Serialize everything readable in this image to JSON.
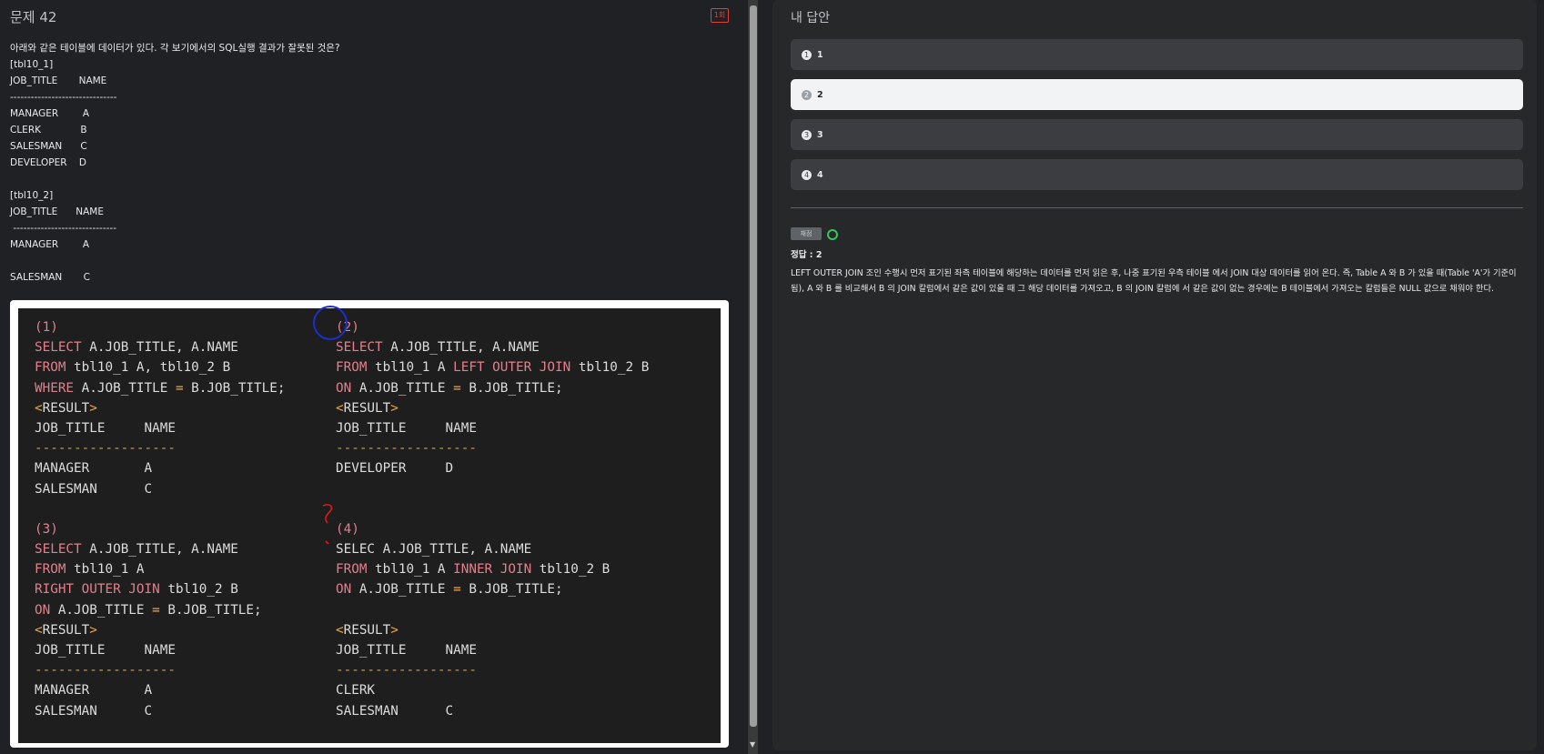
{
  "question": {
    "title": "문제 42",
    "badge": "1회",
    "lines": [
      "아래와 같은 테이블에 데이터가 있다. 각 보기에서의 SQL실행 결과가 잘못된 것은?",
      "[tbl10_1]",
      "JOB_TITLE       NAME",
      "-------------------------------",
      "MANAGER        A",
      "CLERK             B",
      "SALESMAN      C",
      "DEVELOPER    D",
      "",
      "[tbl10_2]",
      "JOB_TITLE      NAME",
      " ------------------------------",
      "MANAGER        A",
      "",
      "SALESMAN       C"
    ]
  },
  "code": {
    "left": [
      [
        {
          "t": "(1)",
          "c": "kw"
        }
      ],
      [
        {
          "t": "SELECT",
          "c": "kw"
        },
        {
          "t": " A.JOB_TITLE, A.NAME"
        }
      ],
      [
        {
          "t": "FROM",
          "c": "kw"
        },
        {
          "t": " tbl10_1 A, tbl10_2 B"
        }
      ],
      [
        {
          "t": "WHERE",
          "c": "kw"
        },
        {
          "t": " A.JOB_TITLE "
        },
        {
          "t": "=",
          "c": "op"
        },
        {
          "t": " B.JOB_TITLE;"
        }
      ],
      [
        {
          "t": "<",
          "c": "op"
        },
        {
          "t": "RESULT"
        },
        {
          "t": ">",
          "c": "op"
        }
      ],
      [
        {
          "t": "JOB_TITLE     NAME"
        }
      ],
      [
        {
          "t": "------------------",
          "c": "dash"
        }
      ],
      [
        {
          "t": "MANAGER       A"
        }
      ],
      [
        {
          "t": "SALESMAN      C"
        }
      ],
      [
        {
          "t": ""
        }
      ],
      [
        {
          "t": "(3)",
          "c": "kw"
        }
      ],
      [
        {
          "t": "SELECT",
          "c": "kw"
        },
        {
          "t": " A.JOB_TITLE, A.NAME"
        }
      ],
      [
        {
          "t": "FROM",
          "c": "kw"
        },
        {
          "t": " tbl10_1 A"
        }
      ],
      [
        {
          "t": "RIGHT OUTER JOIN",
          "c": "kw"
        },
        {
          "t": " tbl10_2 B"
        }
      ],
      [
        {
          "t": "ON",
          "c": "kw"
        },
        {
          "t": " A.JOB_TITLE "
        },
        {
          "t": "=",
          "c": "op"
        },
        {
          "t": " B.JOB_TITLE;"
        }
      ],
      [
        {
          "t": "<",
          "c": "op"
        },
        {
          "t": "RESULT"
        },
        {
          "t": ">",
          "c": "op"
        }
      ],
      [
        {
          "t": "JOB_TITLE     NAME"
        }
      ],
      [
        {
          "t": "------------------",
          "c": "dash"
        }
      ],
      [
        {
          "t": "MANAGER       A"
        }
      ],
      [
        {
          "t": "SALESMAN      C"
        }
      ]
    ],
    "right": [
      [
        {
          "t": "(2)",
          "c": "kw"
        }
      ],
      [
        {
          "t": "SELECT",
          "c": "kw"
        },
        {
          "t": " A.JOB_TITLE, A.NAME"
        }
      ],
      [
        {
          "t": "FROM",
          "c": "kw"
        },
        {
          "t": " tbl10_1 A "
        },
        {
          "t": "LEFT OUTER JOIN",
          "c": "kw"
        },
        {
          "t": " tbl10_2 B"
        }
      ],
      [
        {
          "t": "ON",
          "c": "kw"
        },
        {
          "t": " A.JOB_TITLE "
        },
        {
          "t": "=",
          "c": "op"
        },
        {
          "t": " B.JOB_TITLE;"
        }
      ],
      [
        {
          "t": "<",
          "c": "op"
        },
        {
          "t": "RESULT"
        },
        {
          "t": ">",
          "c": "op"
        }
      ],
      [
        {
          "t": "JOB_TITLE     NAME"
        }
      ],
      [
        {
          "t": "------------------",
          "c": "dash"
        }
      ],
      [
        {
          "t": "DEVELOPER     D"
        }
      ],
      [
        {
          "t": ""
        }
      ],
      [
        {
          "t": ""
        }
      ],
      [
        {
          "t": "(4)",
          "c": "kw"
        }
      ],
      [
        {
          "t": "SELEC A.JOB_TITLE, A.NAME"
        }
      ],
      [
        {
          "t": "FROM",
          "c": "kw"
        },
        {
          "t": " tbl10_1 A "
        },
        {
          "t": "INNER JOIN",
          "c": "kw"
        },
        {
          "t": " tbl10_2 B"
        }
      ],
      [
        {
          "t": "ON",
          "c": "kw"
        },
        {
          "t": " A.JOB_TITLE "
        },
        {
          "t": "=",
          "c": "op"
        },
        {
          "t": " B.JOB_TITLE;"
        }
      ],
      [
        {
          "t": ""
        }
      ],
      [
        {
          "t": "<",
          "c": "op"
        },
        {
          "t": "RESULT"
        },
        {
          "t": ">",
          "c": "op"
        }
      ],
      [
        {
          "t": "JOB_TITLE     NAME"
        }
      ],
      [
        {
          "t": "------------------",
          "c": "dash"
        }
      ],
      [
        {
          "t": "CLERK"
        }
      ],
      [
        {
          "t": "SALESMAN      C"
        }
      ]
    ]
  },
  "answer_panel": {
    "title": "내 답안",
    "options": [
      {
        "num": "1",
        "label": "1",
        "selected": false
      },
      {
        "num": "2",
        "label": "2",
        "selected": true
      },
      {
        "num": "3",
        "label": "3",
        "selected": false
      },
      {
        "num": "4",
        "label": "4",
        "selected": false
      }
    ],
    "grade_chip": "채점",
    "correct_answer": "정답 : 2",
    "explanation": "LEFT OUTER JOIN 조인 수행시 먼저 표기된 좌측 테이블에 해당하는 데이터를 먼저 읽은 후, 나중 표기된 우측 테이블 에서 JOIN 대상 데이터를 읽어 온다. 즉, Table A 와 B 가 있을 때(Table 'A'가 기준이 됨), A 와 B 를 비교해서 B 의 JOIN 칼럼에서 같은 값이 있을 때 그 해당 데이터를 가져오고, B 의 JOIN 칼럼에 서 같은 값이 없는 경우에는 B 테이블에서 가져오는 칼럼들은 NULL 값으로 채워야 한다."
  },
  "colors": {
    "keyword": "#e0808c",
    "operator": "#f2a93b",
    "selected_option_bg": "#f1f3f4",
    "correct_mark": "#34c759"
  }
}
